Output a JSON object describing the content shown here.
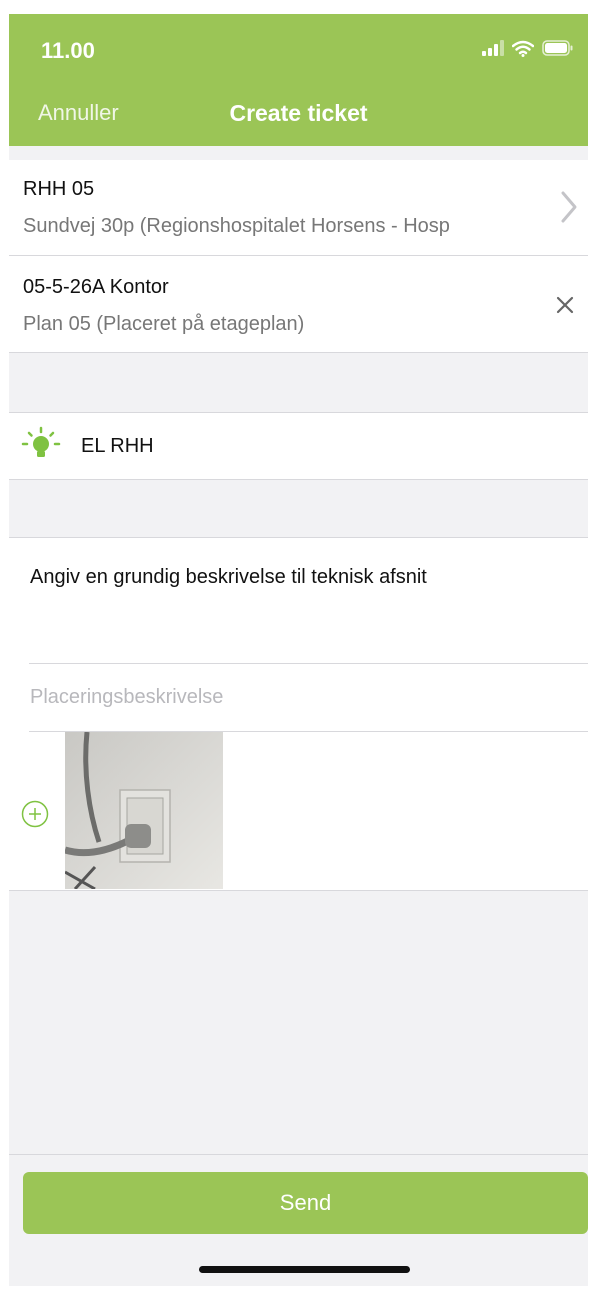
{
  "status_bar": {
    "time": "11.00"
  },
  "header": {
    "cancel_label": "Annuller",
    "title": "Create ticket"
  },
  "location": {
    "title": "RHH 05",
    "subtitle": "Sundvej 30p (Regionshospitalet Horsens - Hosp"
  },
  "room": {
    "title": "05-5-26A Kontor",
    "subtitle": "Plan 05 (Placeret på etageplan)"
  },
  "category": {
    "label": "EL RHH",
    "icon": "lightbulb-icon"
  },
  "description": {
    "value": "Angiv en grundig beskrivelse til teknisk afsnit",
    "location_placeholder": "Placeringsbeskrivelse"
  },
  "send_label": "Send",
  "colors": {
    "accent": "#9bc556",
    "background": "#f2f2f4"
  }
}
